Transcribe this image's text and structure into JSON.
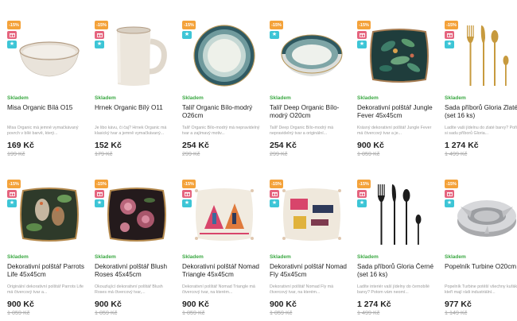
{
  "products": [
    {
      "discount": "-15%",
      "stock": "Skladem",
      "name": "Misa Organic Bílá O15",
      "desc": "Misa Organic má jemně vymačkávaný povrch v bílé barvě, který...",
      "price": "169 Kč",
      "old_price": "199 Kč",
      "image": "bowl-white",
      "has_gift": true
    },
    {
      "discount": "-15%",
      "stock": "Skladem",
      "name": "Hrnek Organic Bílý O11",
      "desc": "Je libo kávu, či čaj? Hrnek Organic má klasický tvar a jemně vymačkávaný...",
      "price": "152 Kč",
      "old_price": "179 Kč",
      "image": "mug-white",
      "has_gift": true
    },
    {
      "discount": "-15%",
      "stock": "Skladem",
      "name": "Talíř Organic Bílo-modrý O26cm",
      "desc": "Talíř Organic Bílo-modrý má nepravidelný tvar a zajímavý motiv...",
      "price": "254 Kč",
      "old_price": "299 Kč",
      "image": "plate-blue",
      "has_gift": false
    },
    {
      "discount": "-15%",
      "stock": "Skladem",
      "name": "Talíř Deep Organic Bílo-modrý O20cm",
      "desc": "Talíř Deep Organic Bílo-modrý má nepravidelný tvar a originální...",
      "price": "254 Kč",
      "old_price": "299 Kč",
      "image": "deep-plate",
      "has_gift": false
    },
    {
      "discount": "-15%",
      "stock": "Skladem",
      "name": "Dekorativní polštář Jungle Fever 45x45cm",
      "desc": "Krásný dekorativní polštář Jungle Fever má čtvercový tvar a je...",
      "price": "900 Kč",
      "old_price": "1 059 Kč",
      "image": "pillow-jungle",
      "has_gift": true
    },
    {
      "discount": "-15%",
      "stock": "Skladem",
      "name": "Sada příborů Gloria Zlaté (set 16 ks)",
      "desc": "Ladíte vaši jídelnu do zlaté barvy? Pořiďte si sadu příborů Gloria...",
      "price": "1 274 Kč",
      "old_price": "1 499 Kč",
      "image": "cutlery-gold",
      "has_gift": true
    },
    {
      "discount": "-15%",
      "stock": "Skladem",
      "name": "Dekorativní polštář Parrots Life 45x45cm",
      "desc": "Originální dekorativní polštář Parrots Life má čtvercový tvar a...",
      "price": "900 Kč",
      "old_price": "1 059 Kč",
      "image": "pillow-parrots",
      "has_gift": true
    },
    {
      "discount": "-15%",
      "stock": "Skladem",
      "name": "Dekorativní polštář Blush Roses 45x45cm",
      "desc": "Okouzlující dekorativní polštář Blush Roses má čtvercový tvar,...",
      "price": "900 Kč",
      "old_price": "1 059 Kč",
      "image": "pillow-roses",
      "has_gift": true
    },
    {
      "discount": "-15%",
      "stock": "Skladem",
      "name": "Dekorativní polštář Nomad Triangle 45x45cm",
      "desc": "Dekorativní polštář Nomad Triangle má čtvercový tvar, na kterém...",
      "price": "900 Kč",
      "old_price": "1 059 Kč",
      "image": "pillow-nomad-tri",
      "has_gift": true
    },
    {
      "discount": "-15%",
      "stock": "Skladem",
      "name": "Dekorativní polštář Nomad Fly 45x45cm",
      "desc": "Dekorativní polštář Nomad Fly má čtvercový tvar, na kterém...",
      "price": "900 Kč",
      "old_price": "1 059 Kč",
      "image": "pillow-nomad-fly",
      "has_gift": true
    },
    {
      "discount": "-15%",
      "stock": "Skladem",
      "name": "Sada příborů Gloria Černé (set 16 ks)",
      "desc": "Ladíte interiér vaší jídelny do černobílé barvy? Potom vám neomí...",
      "price": "1 274 Kč",
      "old_price": "1 499 Kč",
      "image": "cutlery-black",
      "has_gift": true
    },
    {
      "discount": "-15%",
      "stock": "Skladem",
      "name": "Popelník Turbine O20cm",
      "desc": "Popelník Turbine potěší všechny kuřáky, kteří mají rádi industriální...",
      "price": "977 Kč",
      "old_price": "1 149 Kč",
      "image": "ashtray",
      "has_gift": true
    }
  ],
  "colors": {
    "discount_badge": "#f4a23a",
    "gift_badge": "#e5647e",
    "star_badge": "#3dc5d6",
    "stock_green": "#3aa842"
  }
}
